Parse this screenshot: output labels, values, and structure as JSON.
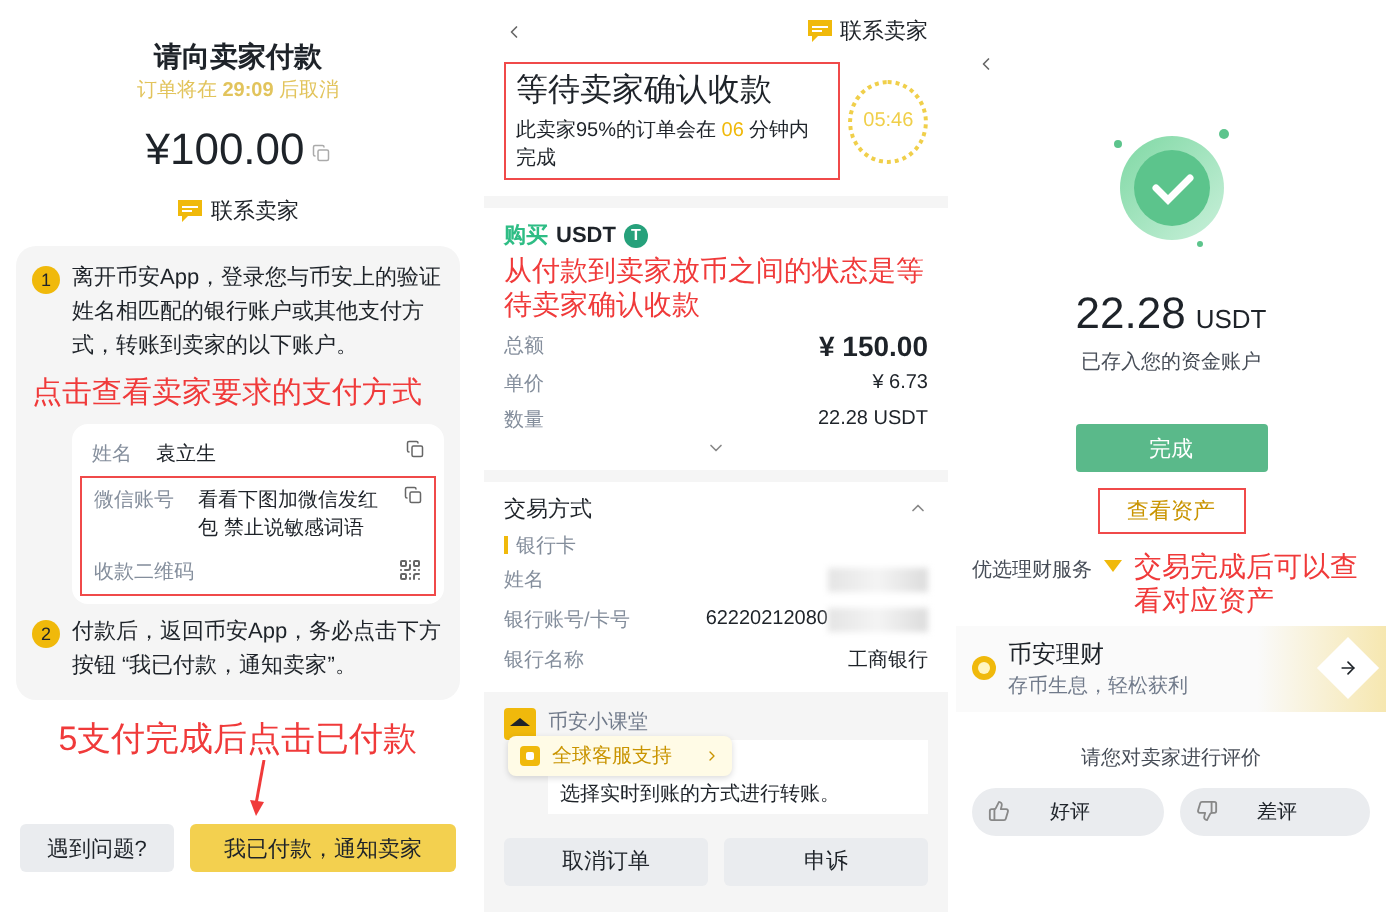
{
  "pay_screen": {
    "title": "请向卖家付款",
    "countdown": {
      "prefix": "订单将在",
      "time": "29:09",
      "suffix": "后取消"
    },
    "amount": "¥100.00",
    "contact": "联系卖家",
    "steps": [
      {
        "number": "1",
        "text": "离开币安App，登录您与币安上的验证姓名相匹配的银行账户或其他支付方式，转账到卖家的以下账户。"
      },
      {
        "number": "2",
        "text": "付款后，返回币安App，务必点击下方按钮 “我已付款，通知卖家”。"
      }
    ],
    "account_annotation": "点击查看卖家要求的支付方式",
    "account_rows": [
      {
        "label": "姓名",
        "value": "袁立生",
        "kind": "copy"
      }
    ],
    "highlighted_rows": [
      {
        "label": "微信账号",
        "value": "看看下图加微信发红包 禁止说敏感词语",
        "kind": "copy"
      },
      {
        "label": "收款二维码",
        "kind": "qr"
      }
    ],
    "button_annotation": "5支付完成后点击已付款",
    "buttons": [
      {
        "label": "遇到问题?",
        "kind": "secondary"
      },
      {
        "label": "我已付款，通知卖家",
        "kind": "primary"
      }
    ]
  },
  "waiting_screen": {
    "contact": "联系卖家",
    "status": {
      "title": "等待卖家确认收款",
      "note_prefix": "此卖家95%的订单会在",
      "note_highlight": "06",
      "note_suffix": "分钟内完成"
    },
    "timer": "05:46",
    "order": {
      "side": "购买",
      "asset": "USDT",
      "asset_icon": "T",
      "annotation": "从付款到卖家放币之间的状态是等待卖家确认收款",
      "rows": [
        {
          "label": "总额",
          "value": "¥ 150.00",
          "kind": "total"
        },
        {
          "label": "单价",
          "value": "¥ 6.73",
          "kind": "plain"
        },
        {
          "label": "数量",
          "value": "22.28 USDT",
          "kind": "plain"
        }
      ]
    },
    "payment": {
      "title": "交易方式",
      "method": "银行卡",
      "rows": [
        {
          "label": "姓名",
          "redacted": true
        },
        {
          "label": "银行账号/卡号",
          "value": "62220212080",
          "redacted": true
        },
        {
          "label": "银行名称",
          "value": "工商银行",
          "redacted": false
        }
      ]
    },
    "lesson": {
      "title": "币安小课堂",
      "text": "选择实时到账的方式进行转账。"
    },
    "tooltip": "全球客服支持",
    "buttons": [
      "取消订单",
      "申诉"
    ]
  },
  "done_screen": {
    "amount": "22.28",
    "unit": "USDT",
    "note": "已存入您的资金账户",
    "done_button": "完成",
    "assets_link": "查看资产",
    "services_label": "优选理财服务",
    "annotation": "交易完成后可以查看对应资产",
    "product": {
      "name": "币安理财",
      "tagline": "存币生息，轻松获利"
    },
    "rating_prompt": "请您对卖家进行评价",
    "ratings": [
      {
        "label": "好评",
        "kind": "up"
      },
      {
        "label": "差评",
        "kind": "down"
      }
    ]
  }
}
